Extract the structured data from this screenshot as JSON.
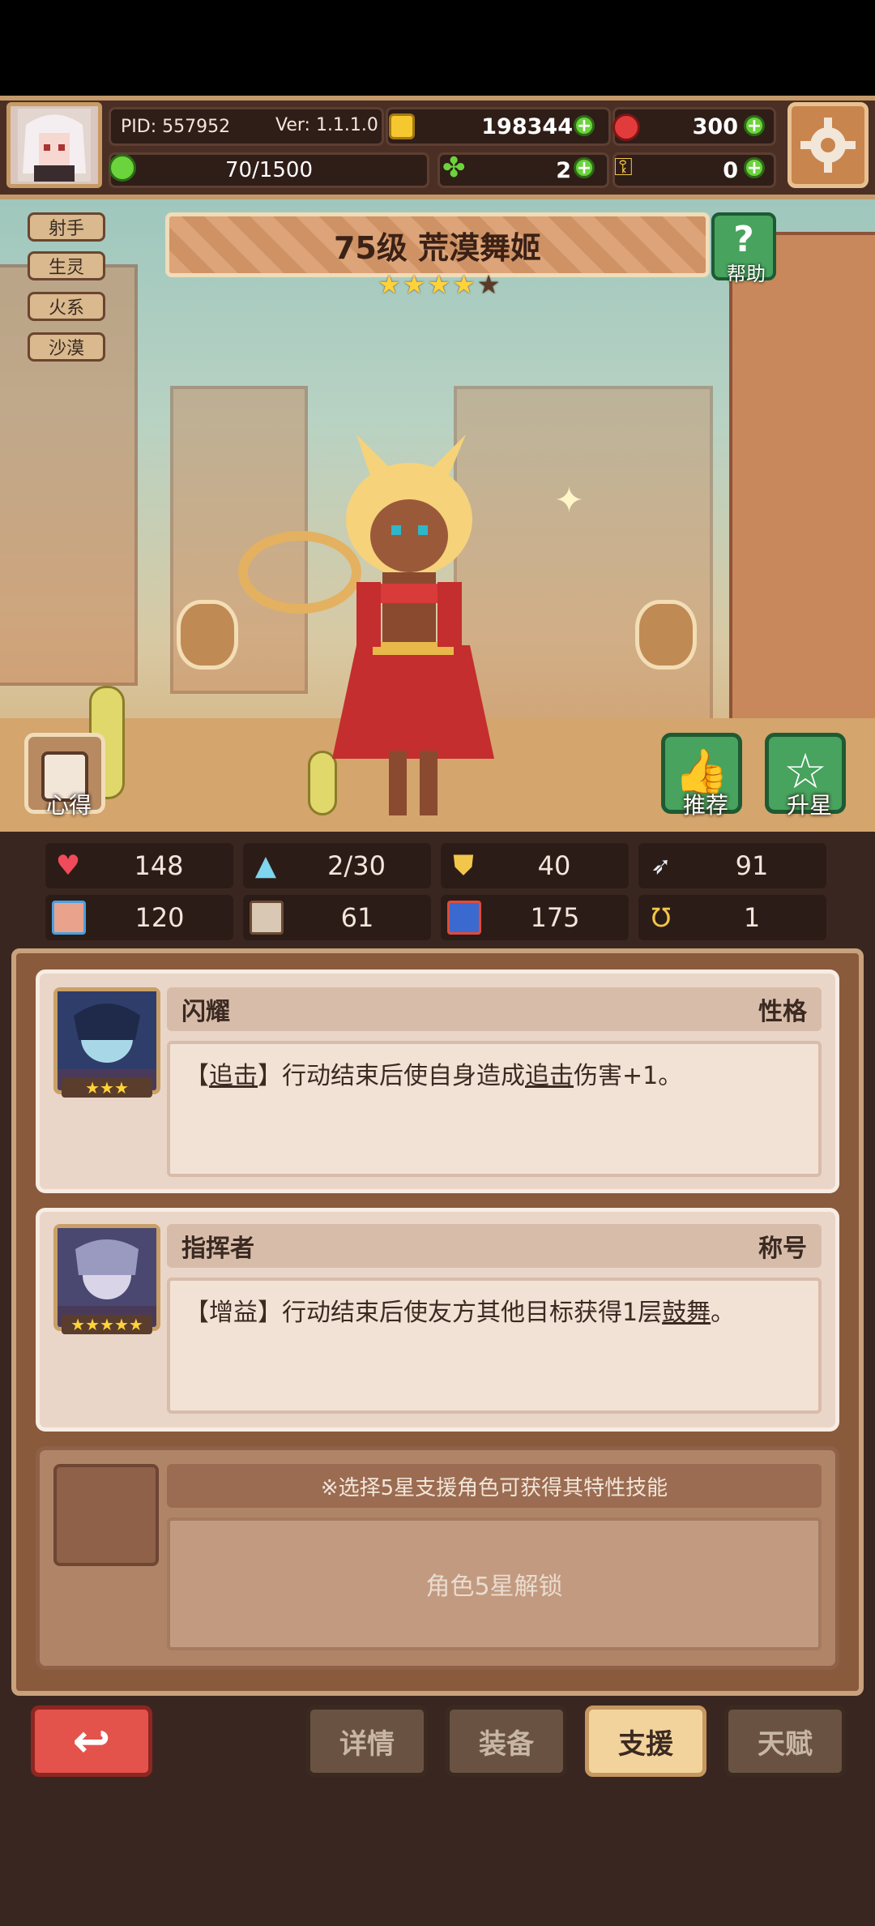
{
  "header": {
    "pid": "PID: 557952",
    "version": "Ver: 1.1.1.0",
    "gold": "198344",
    "gems": "300",
    "stamina": "70/1500",
    "clover": "2",
    "key": "0"
  },
  "tags": [
    "射手",
    "生灵",
    "火系",
    "沙漠"
  ],
  "character": {
    "title": "75级  荒漠舞姬",
    "stars_filled": 4,
    "stars_total": 5
  },
  "buttons": {
    "help": "帮助",
    "notes": "心得",
    "recommend": "推荐",
    "star_up": "升星"
  },
  "stats": {
    "hp": "148",
    "mana": "2/30",
    "defense": "40",
    "speed": "91",
    "attack": "120",
    "magic": "61",
    "power": "175",
    "crit": "1"
  },
  "support": {
    "slot1": {
      "name": "闪耀",
      "type": "性格",
      "portrait_stars": "★★★",
      "desc_parts": [
        "【",
        "追击",
        "】行动结束后使自身造成",
        "追击",
        "伤害+1。"
      ]
    },
    "slot2": {
      "name": "指挥者",
      "type": "称号",
      "portrait_stars": "★★★★★",
      "desc_parts": [
        "【增益】行动结束后使友方其他目标获得1层",
        "鼓舞",
        "。"
      ]
    },
    "slot3": {
      "hint": "※选择5星支援角色可获得其特性技能",
      "locked": "角色5星解锁"
    }
  },
  "tabs": [
    "详情",
    "装备",
    "支援",
    "天赋"
  ],
  "active_tab": "支援"
}
